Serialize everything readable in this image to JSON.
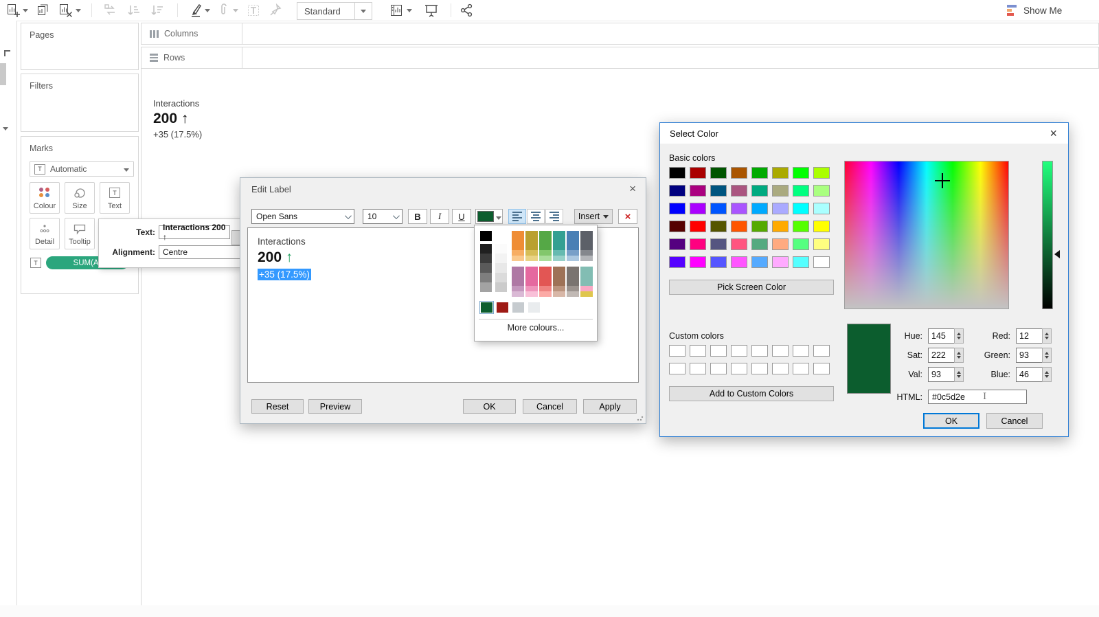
{
  "toolbar": {
    "fit_label": "Standard",
    "show_me_label": "Show Me"
  },
  "shelves": {
    "columns_label": "Columns",
    "rows_label": "Rows"
  },
  "cards": {
    "pages_label": "Pages",
    "filters_label": "Filters",
    "marks_label": "Marks",
    "mark_type_label": "Automatic",
    "text_icon_glyph": "T",
    "buttons": {
      "colour": "Colour",
      "size": "Size",
      "text": "Text",
      "detail": "Detail",
      "tooltip": "Tooltip"
    },
    "pill_label": "SUM(A)",
    "pill_color": "#2ba67d"
  },
  "canvas": {
    "title": "Interactions",
    "value": "200",
    "arrow": "↑",
    "delta": "+35 (17.5%)"
  },
  "text_popup": {
    "text_label": "Text:",
    "text_value": "Interactions 200 ↑",
    "alignment_label": "Alignment:",
    "alignment_value": "Centre"
  },
  "edit_label": {
    "title": "Edit Label",
    "close": "×",
    "font_name": "Open Sans",
    "font_size": "10",
    "bold": "B",
    "italic": "I",
    "underline": "U",
    "insert_label": "Insert",
    "delete_label": "×",
    "selected_color": "#0c5d2e",
    "selection_color": "#3399ff",
    "arrow_color": "#23a161",
    "body_title": "Interactions",
    "body_value": "200",
    "body_arrow": "↑",
    "body_delta": "+35 (17.5%)",
    "reset": "Reset",
    "preview": "Preview",
    "ok": "OK",
    "cancel": "Cancel",
    "apply": "Apply"
  },
  "color_dropdown": {
    "more_label": "More colours...",
    "grey_column": [
      "#000000",
      "#202020",
      "#3b3b3b",
      "#5a5a5a",
      "#7e7e7e",
      "#a3a3a3"
    ],
    "white_column": [
      "#ffffff",
      "#fbfbfb",
      "#f3f3f3",
      "#e8e8e8",
      "#dbdbdb",
      "#cbcbcb"
    ],
    "palette_columns_top": [
      [
        "#ef8d35",
        "#f7ad63",
        "#fac88c"
      ],
      [
        "#b9a02f",
        "#d6bd57",
        "#e9d384"
      ],
      [
        "#55a846",
        "#83c76c",
        "#aadd9a"
      ],
      [
        "#33a092",
        "#66bab0",
        "#97d1c9"
      ],
      [
        "#4a80b5",
        "#789fc8",
        "#abc7e0"
      ],
      [
        "#5c6068",
        "#84878d",
        "#b3b5b9"
      ]
    ],
    "palette_columns_bottom": [
      [
        "#af78a4",
        "#c497bd",
        "#dab9d5"
      ],
      [
        "#e5699f",
        "#ef94bb",
        "#f9c0d8"
      ],
      [
        "#e25654",
        "#ef8381",
        "#fcaaa6"
      ],
      [
        "#9e7257",
        "#bb947e",
        "#d8b7a7"
      ],
      [
        "#7a7470",
        "#9b938e",
        "#c1b9b4"
      ],
      [
        "#82bdb3",
        "#f9a9c4",
        "#dfc64d"
      ]
    ],
    "bottom_row": [
      "#0c5d2e",
      "#9e1a15",
      "#c6cbcf",
      "#e9ecee"
    ]
  },
  "select_color": {
    "title": "Select Color",
    "close": "×",
    "basic_label": "Basic colors",
    "basic_colors": [
      "#000000",
      "#aa0000",
      "#005500",
      "#aa5500",
      "#00aa00",
      "#aaaa00",
      "#00ff00",
      "#aaff00",
      "#000080",
      "#aa0080",
      "#005580",
      "#aa5580",
      "#00aa80",
      "#aaaa80",
      "#00ff80",
      "#aaff80",
      "#0000ff",
      "#aa00ff",
      "#0055ff",
      "#aa55ff",
      "#00aaff",
      "#aaaaff",
      "#00ffff",
      "#aaffff",
      "#550000",
      "#ff0000",
      "#555500",
      "#ff5500",
      "#55aa00",
      "#ffaa00",
      "#55ff00",
      "#ffff00",
      "#550080",
      "#ff0080",
      "#555580",
      "#ff5580",
      "#55aa80",
      "#ffaa80",
      "#55ff80",
      "#ffff80",
      "#5500ff",
      "#ff00ff",
      "#5555ff",
      "#ff55ff",
      "#55aaff",
      "#ffaaff",
      "#55ffff",
      "#ffffff"
    ],
    "pick_screen_label": "Pick Screen Color",
    "custom_label": "Custom colors",
    "custom_colors": [
      "#ffffff",
      "#ffffff",
      "#ffffff",
      "#ffffff",
      "#ffffff",
      "#ffffff",
      "#ffffff",
      "#ffffff",
      "#ffffff",
      "#ffffff",
      "#ffffff",
      "#ffffff",
      "#ffffff",
      "#ffffff",
      "#ffffff",
      "#ffffff"
    ],
    "add_custom_label": "Add to Custom Colors",
    "preview_color": "#0c5d2e",
    "slider_top_color": "#21ff7d",
    "hue_label": "Hue:",
    "hue_value": "145",
    "sat_label": "Sat:",
    "sat_value": "222",
    "val_label": "Val:",
    "val_value": "93",
    "red_label": "Red:",
    "red_value": "12",
    "green_label": "Green:",
    "green_value": "93",
    "blue_label": "Blue:",
    "blue_value": "46",
    "html_label": "HTML:",
    "html_value": "#0c5d2e",
    "ok": "OK",
    "cancel": "Cancel"
  }
}
